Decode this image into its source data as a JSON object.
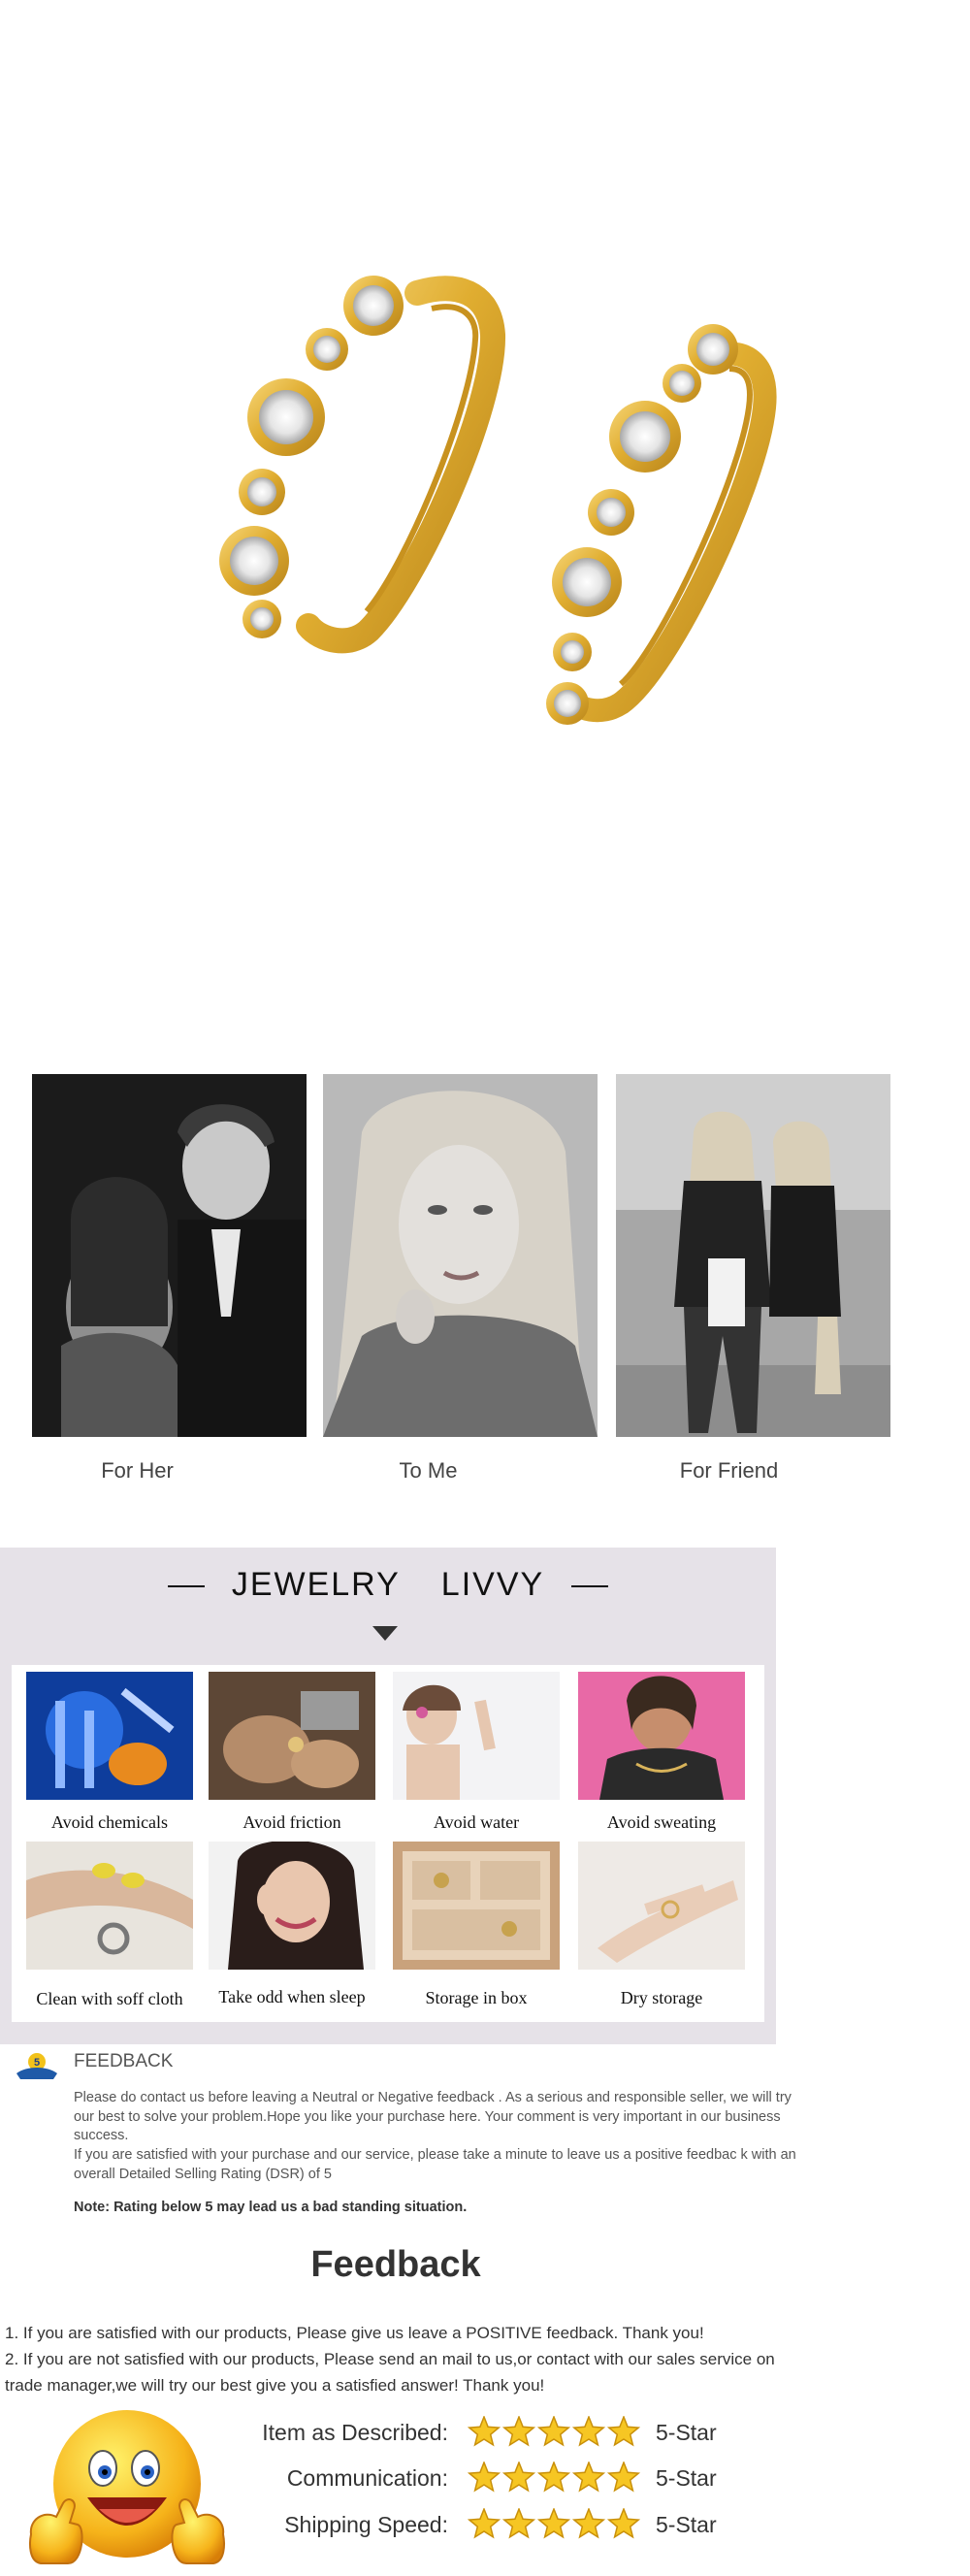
{
  "product": {
    "image": "gold-huggie-hoop-earrings-with-bezel-set-stones"
  },
  "audience": [
    {
      "caption": "For Her",
      "image": "couple-bw-photo"
    },
    {
      "caption": "To Me",
      "image": "woman-portrait-bw-photo"
    },
    {
      "caption": "For Friend",
      "image": "friends-street-bw-photo"
    }
  ],
  "care": {
    "brand_left": "JEWELRY",
    "brand_right": "LIVVY",
    "tips": [
      {
        "caption": "Avoid chemicals",
        "image": "lab-chemicals-photo"
      },
      {
        "caption": "Avoid friction",
        "image": "grinding-tool-photo"
      },
      {
        "caption": "Avoid water",
        "image": "woman-water-photo"
      },
      {
        "caption": "Avoid sweating",
        "image": "woman-sweating-photo"
      },
      {
        "caption": "Clean with soff cloth",
        "image": "cleaning-ring-photo"
      },
      {
        "caption": "Take odd when sleep",
        "image": "woman-earring-photo"
      },
      {
        "caption": "Storage in box",
        "image": "jewelry-box-photo"
      },
      {
        "caption": "Dry storage",
        "image": "hand-ring-photo"
      }
    ]
  },
  "feedback_note": {
    "badge": "5",
    "heading": "FEEDBACK",
    "para1": "Please do contact us before leaving a Neutral or Negative  feedback . As a serious and responsible seller, we will try our best to solve your problem.Hope you like your purchase here. Your comment is very important in our business success.",
    "para2": " If you are satisfied with your purchase and our service,  please take a minute to leave us  a positive feedbac k with an overall  Detailed Selling Rating (DSR) of 5",
    "note": "Note: Rating below 5 may lead us a bad standing situation."
  },
  "feedback": {
    "title": "Feedback",
    "line1": "1. If you are satisfied with our products, Please give us leave a POSITIVE feedback. Thank you!",
    "line2": "2. If you are not satisfied with our products, Please send an mail to us,or contact with our sales service on trade manager,we will try our best give you a satisfied answer! Thank you!",
    "ratings": [
      {
        "label": "Item as Described:",
        "stars": 5,
        "value": "5-Star"
      },
      {
        "label": "Communication:",
        "stars": 5,
        "value": "5-Star"
      },
      {
        "label": "Shipping Speed:",
        "stars": 5,
        "value": "5-Star"
      }
    ]
  },
  "colors": {
    "gold": "#e3b53a",
    "star": "#f6c623",
    "panel": "#e6e2e8"
  }
}
